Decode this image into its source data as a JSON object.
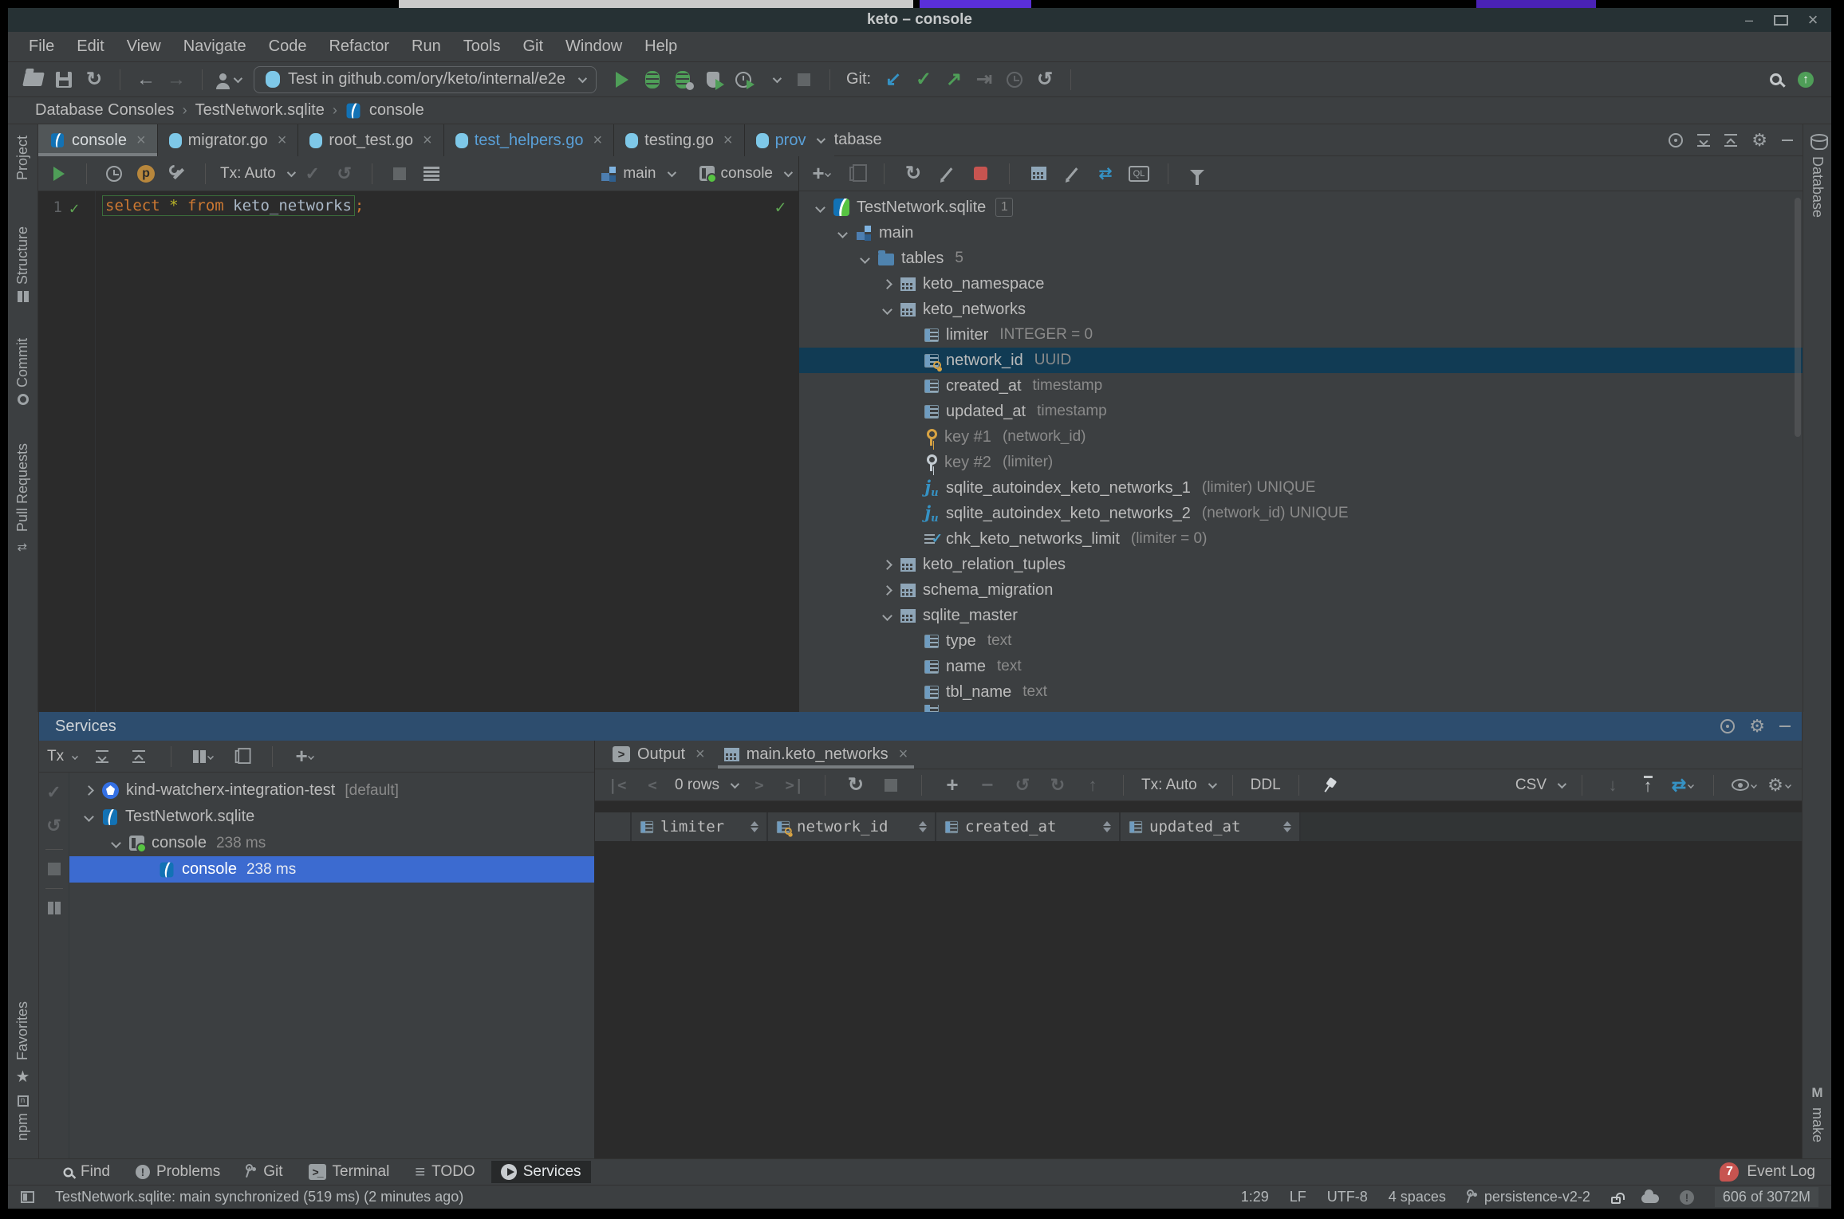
{
  "window": {
    "title": "keto – console"
  },
  "menu": {
    "items": [
      "File",
      "Edit",
      "View",
      "Navigate",
      "Code",
      "Refactor",
      "Run",
      "Tools",
      "Git",
      "Window",
      "Help"
    ]
  },
  "toolbar": {
    "run_config": "Test in github.com/ory/keto/internal/e2e",
    "git_label": "Git:"
  },
  "breadcrumbs": {
    "root": "Database Consoles",
    "db": "TestNetwork.sqlite",
    "leaf": "console"
  },
  "tabs": {
    "items": [
      "console",
      "migrator.go",
      "root_test.go",
      "test_helpers.go",
      "testing.go",
      "prov"
    ]
  },
  "console_bar": {
    "tx": "Tx: Auto",
    "schema": "main",
    "session": "console"
  },
  "editor": {
    "line1_number": "1",
    "kw_select": "select ",
    "star": "* ",
    "kw_from": "from ",
    "table_ref": "keto_networks",
    "semicolon": ";"
  },
  "db": {
    "title": "Database",
    "side_label": "Database",
    "tree": [
      {
        "label": "TestNetwork.sqlite",
        "badge": "1"
      },
      {
        "label": "main"
      },
      {
        "label": "tables",
        "meta": "5"
      },
      {
        "label": "keto_namespace"
      },
      {
        "label": "keto_networks"
      },
      {
        "label": "limiter",
        "meta": "INTEGER = 0"
      },
      {
        "label": "network_id",
        "meta": "UUID"
      },
      {
        "label": "created_at",
        "meta": "timestamp"
      },
      {
        "label": "updated_at",
        "meta": "timestamp"
      },
      {
        "label": "key #1",
        "meta": "(network_id)"
      },
      {
        "label": "key #2",
        "meta": "(limiter)"
      },
      {
        "label": "sqlite_autoindex_keto_networks_1",
        "meta": "(limiter) UNIQUE"
      },
      {
        "label": "sqlite_autoindex_keto_networks_2",
        "meta": "(network_id) UNIQUE"
      },
      {
        "label": "chk_keto_networks_limit",
        "meta": "(limiter = 0)"
      },
      {
        "label": "keto_relation_tuples"
      },
      {
        "label": "schema_migration"
      },
      {
        "label": "sqlite_master"
      },
      {
        "label": "type",
        "meta": "text"
      },
      {
        "label": "name",
        "meta": "text"
      },
      {
        "label": "tbl_name",
        "meta": "text"
      }
    ]
  },
  "services": {
    "title": "Services",
    "tx_label": "Tx",
    "tree": [
      {
        "label": "kind-watcherx-integration-test",
        "meta": "[default]"
      },
      {
        "label": "TestNetwork.sqlite"
      },
      {
        "label": "console",
        "meta": "238 ms"
      },
      {
        "label": "console",
        "meta": "238 ms"
      }
    ]
  },
  "result": {
    "tab_output": "Output",
    "tab_grid": "main.keto_networks",
    "toolbar": {
      "rows": "0 rows",
      "tx": "Tx: Auto",
      "ddl": "DDL",
      "format": "CSV"
    },
    "headers": [
      "limiter",
      "network_id",
      "created_at",
      "updated_at"
    ]
  },
  "bottom_bar": {
    "items": [
      "Find",
      "Problems",
      "Git",
      "Terminal",
      "TODO",
      "Services"
    ],
    "event_count": "7",
    "event_log": "Event Log"
  },
  "status": {
    "message": "TestNetwork.sqlite: main synchronized (519 ms) (2 minutes ago)",
    "caret": "1:29",
    "line_ending": "LF",
    "encoding": "UTF-8",
    "indent": "4 spaces",
    "branch": "persistence-v2-2",
    "memory": "606 of 3072M"
  },
  "stripes": {
    "left": [
      "Project",
      "Structure",
      "Commit",
      "Pull Requests"
    ],
    "left_bottom": [
      "Favorites",
      "npm"
    ],
    "right_top": "Database",
    "right_bottom": "make"
  },
  "colors": {
    "selection_active": "#3c6bd0",
    "selection_inactive": "#113b54",
    "services_header": "#2d4d6e",
    "modified_file_blue": "#5aa0d8",
    "keyword_orange": "#cc7832",
    "run_green": "#4f9e58",
    "error_badge_red": "#c75450",
    "key_gold": "#d8a343",
    "index_blue": "#3592c4"
  }
}
